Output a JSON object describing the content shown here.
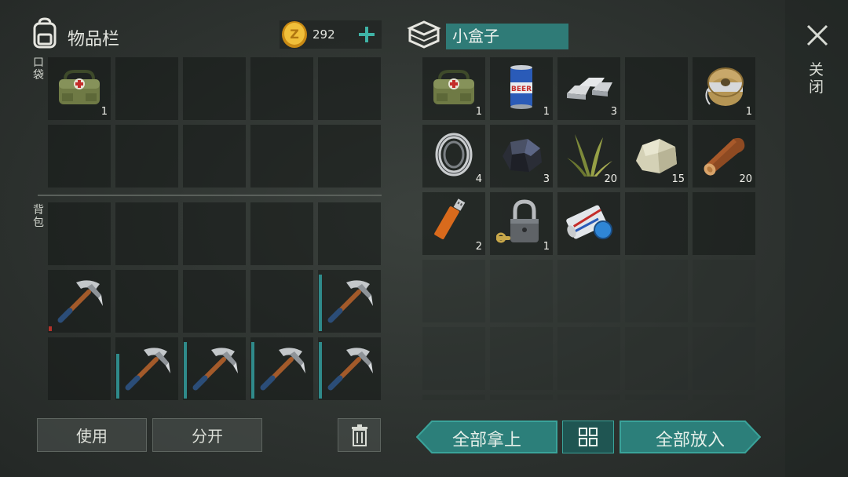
{
  "inventory": {
    "title": "物品栏",
    "coins": "292",
    "pocket_label": "口袋",
    "backpack_label": "背包",
    "pocket_slots": [
      {
        "icon": "medkit-bag-icon",
        "qty": "1"
      },
      {},
      {},
      {},
      {},
      {},
      {},
      {},
      {},
      {}
    ],
    "backpack_slots": [
      {},
      {},
      {},
      {},
      {},
      {
        "icon": "pickaxe-icon",
        "durability": 0.08,
        "dur_color": "#b3322a"
      },
      {},
      {},
      {},
      {
        "icon": "pickaxe-icon",
        "durability": 0.95,
        "dur_color": "#2f8a8a"
      },
      {},
      {
        "icon": "pickaxe-icon",
        "durability": 0.75,
        "dur_color": "#2f8a8a"
      },
      {
        "icon": "pickaxe-icon",
        "durability": 0.95,
        "dur_color": "#2f8a8a"
      },
      {
        "icon": "pickaxe-icon",
        "durability": 0.95,
        "dur_color": "#2f8a8a"
      },
      {
        "icon": "pickaxe-icon",
        "durability": 0.95,
        "dur_color": "#2f8a8a"
      }
    ],
    "use_label": "使用",
    "split_label": "分开"
  },
  "container": {
    "name": "小盒子",
    "slots": [
      {
        "icon": "medkit-bag-icon",
        "qty": "1"
      },
      {
        "icon": "beer-can-icon",
        "qty": "1"
      },
      {
        "icon": "metal-ingot-icon",
        "qty": "3"
      },
      {},
      {
        "icon": "wire-spool-icon",
        "qty": "1"
      },
      {
        "icon": "bearing-ring-icon",
        "qty": "4"
      },
      {
        "icon": "coal-ore-icon",
        "qty": "3"
      },
      {
        "icon": "plant-fiber-icon",
        "qty": "20"
      },
      {
        "icon": "stone-icon",
        "qty": "15"
      },
      {
        "icon": "wood-log-icon",
        "qty": "20"
      },
      {
        "icon": "usb-drive-icon",
        "qty": "2"
      },
      {
        "icon": "padlock-icon",
        "qty": "1"
      },
      {
        "icon": "map-scroll-icon",
        "qty": ""
      },
      {},
      {}
    ],
    "take_all_label": "全部拿上",
    "put_all_label": "全部放入"
  },
  "close_label": "关闭",
  "colors": {
    "teal": "#2c7f7a",
    "teal_light": "#3aa39a",
    "coin": "#e0a82a"
  }
}
